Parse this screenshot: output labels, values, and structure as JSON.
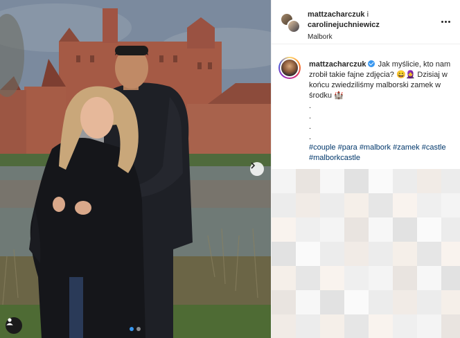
{
  "post": {
    "header": {
      "user_primary": "mattzacharczuk",
      "conjunction": "i",
      "user_secondary": "carolinejuchniewicz",
      "location": "Malbork"
    },
    "caption": {
      "username": "mattzacharczuk",
      "line1": "Jak myślicie, kto nam zrobił takie fajne zdjęcia? 😄🧕",
      "line2": "Dzisiaj w końcu zwiedziliśmy malborski zamek w środku 🏰",
      "dots": [
        ".",
        ".",
        ".",
        "."
      ],
      "hashtags": [
        "#couple",
        "#para",
        "#malbork",
        "#zamek",
        "#castle",
        "#malborkcastle"
      ]
    },
    "carousel": {
      "slides": 2,
      "active_slide": 1
    }
  },
  "icons": {
    "more": "more-options-icon",
    "next": "chevron-right-icon",
    "tag": "user-tag-icon",
    "verified": "verified-badge-icon"
  },
  "colors": {
    "hashtag": "#00376b",
    "verified": "#3897f0",
    "carousel_active_dot": "#3897f0"
  }
}
